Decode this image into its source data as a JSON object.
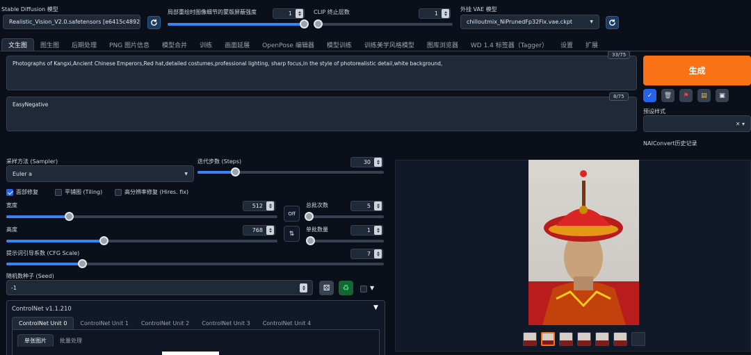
{
  "top": {
    "sd_model_label": "Stable Diffusion 模型",
    "sd_model_value": "Realistic_Vision_V2.0.safetensors [e6415c4892]",
    "mask_blur_label": "局部重绘时图像细节的蒙版屏蔽强度",
    "mask_blur_value": "1",
    "mask_blur_fraction": 1.0,
    "clip_label": "CLIP 终止层数",
    "clip_value": "1",
    "clip_fraction": 0.0,
    "vae_label": "外挂 VAE 模型",
    "vae_value": "chilloutmix_NiPrunedFp32Fix.vae.ckpt"
  },
  "tabs": [
    "文生图",
    "图生图",
    "后期处理",
    "PNG 图片信息",
    "模型合并",
    "训练",
    "画面延展",
    "OpenPose 编辑器",
    "模型训练",
    "训练美学风格模型",
    "图库浏览器",
    "WD 1.4 标签器（Tagger）",
    "设置",
    "扩展"
  ],
  "prompt": {
    "positive": "Photographs of Kangxi,Ancient Chinese Emperors,Red hat,detailed costumes,professional lighting, sharp focus,in the style of photorealistic detail,white background,",
    "positive_count": "33/75",
    "negative": "EasyNegative",
    "negative_count": "8/75"
  },
  "right": {
    "generate_label": "生成",
    "styles_label": "预设样式",
    "naiconvert_label": "NAIConvert历史记录"
  },
  "params": {
    "sampler_label": "采样方法 (Sampler)",
    "sampler_value": "Euler a",
    "steps_label": "迭代步数 (Steps)",
    "steps_value": "30",
    "steps_fraction": 0.2,
    "face_restore_label": "面部修复",
    "face_restore_checked": true,
    "tiling_label": "平铺图 (Tiling)",
    "hires_label": "高分辨率修复 (Hires. fix)",
    "width_label": "宽度",
    "width_value": "512",
    "width_fraction": 0.23,
    "height_label": "高度",
    "height_value": "768",
    "height_fraction": 0.36,
    "off_label": "Off",
    "swap_label": "⇅",
    "batch_count_label": "总批次数",
    "batch_count_value": "5",
    "batch_count_fraction": 0.04,
    "batch_size_label": "单批数量",
    "batch_size_value": "1",
    "batch_size_fraction": 0.0,
    "cfg_label": "提示词引导系数 (CFG Scale)",
    "cfg_value": "7",
    "cfg_fraction": 0.2,
    "seed_label": "随机数种子 (Seed)",
    "seed_value": "-1"
  },
  "controlnet": {
    "title": "ControlNet v1.1.210",
    "units": [
      "ControlNet Unit 0",
      "ControlNet Unit 1",
      "ControlNet Unit 2",
      "ControlNet Unit 3",
      "ControlNet Unit 4"
    ],
    "subtabs": [
      "单张图片",
      "批量处理"
    ]
  },
  "icons": {
    "refresh": "refresh-icon",
    "dice": "dice-icon",
    "recycle": "recycle-icon"
  },
  "colors": {
    "generate": "#f97316",
    "accent": "#3b82f6"
  }
}
